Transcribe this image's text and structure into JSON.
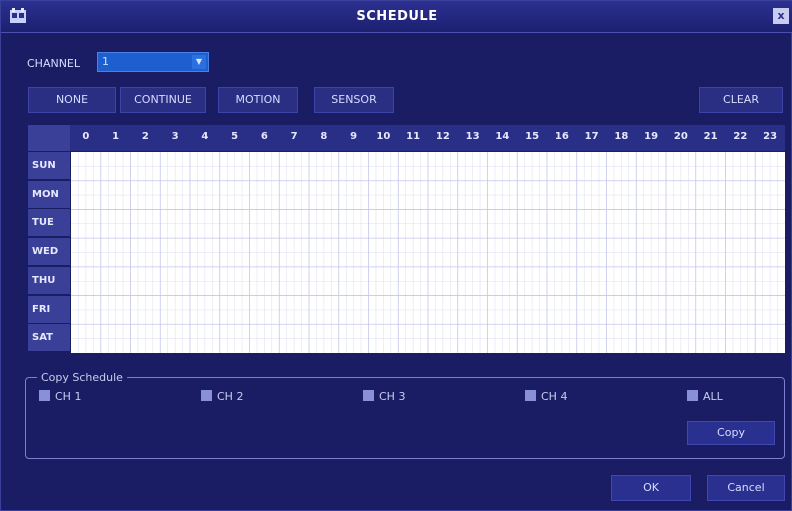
{
  "window": {
    "title": "SCHEDULE",
    "close_label": "x"
  },
  "channel": {
    "label": "CHANNEL",
    "value": "1"
  },
  "modes": [
    "NONE",
    "CONTINUE",
    "MOTION",
    "SENSOR"
  ],
  "clear_label": "CLEAR",
  "hours": [
    "0",
    "1",
    "2",
    "3",
    "4",
    "5",
    "6",
    "7",
    "8",
    "9",
    "10",
    "11",
    "12",
    "13",
    "14",
    "15",
    "16",
    "17",
    "18",
    "19",
    "20",
    "21",
    "22",
    "23"
  ],
  "days": [
    "SUN",
    "MON",
    "TUE",
    "WED",
    "THU",
    "FRI",
    "SAT"
  ],
  "copy_schedule": {
    "title": "Copy Schedule",
    "options": [
      "CH 1",
      "CH 2",
      "CH 3",
      "CH 4",
      "ALL"
    ],
    "button": "Copy"
  },
  "footer": {
    "ok": "OK",
    "cancel": "Cancel"
  },
  "colors": {
    "background": "#1a1d63",
    "grid_line": "#c4c6ea",
    "selection": "#1e5fd0"
  }
}
